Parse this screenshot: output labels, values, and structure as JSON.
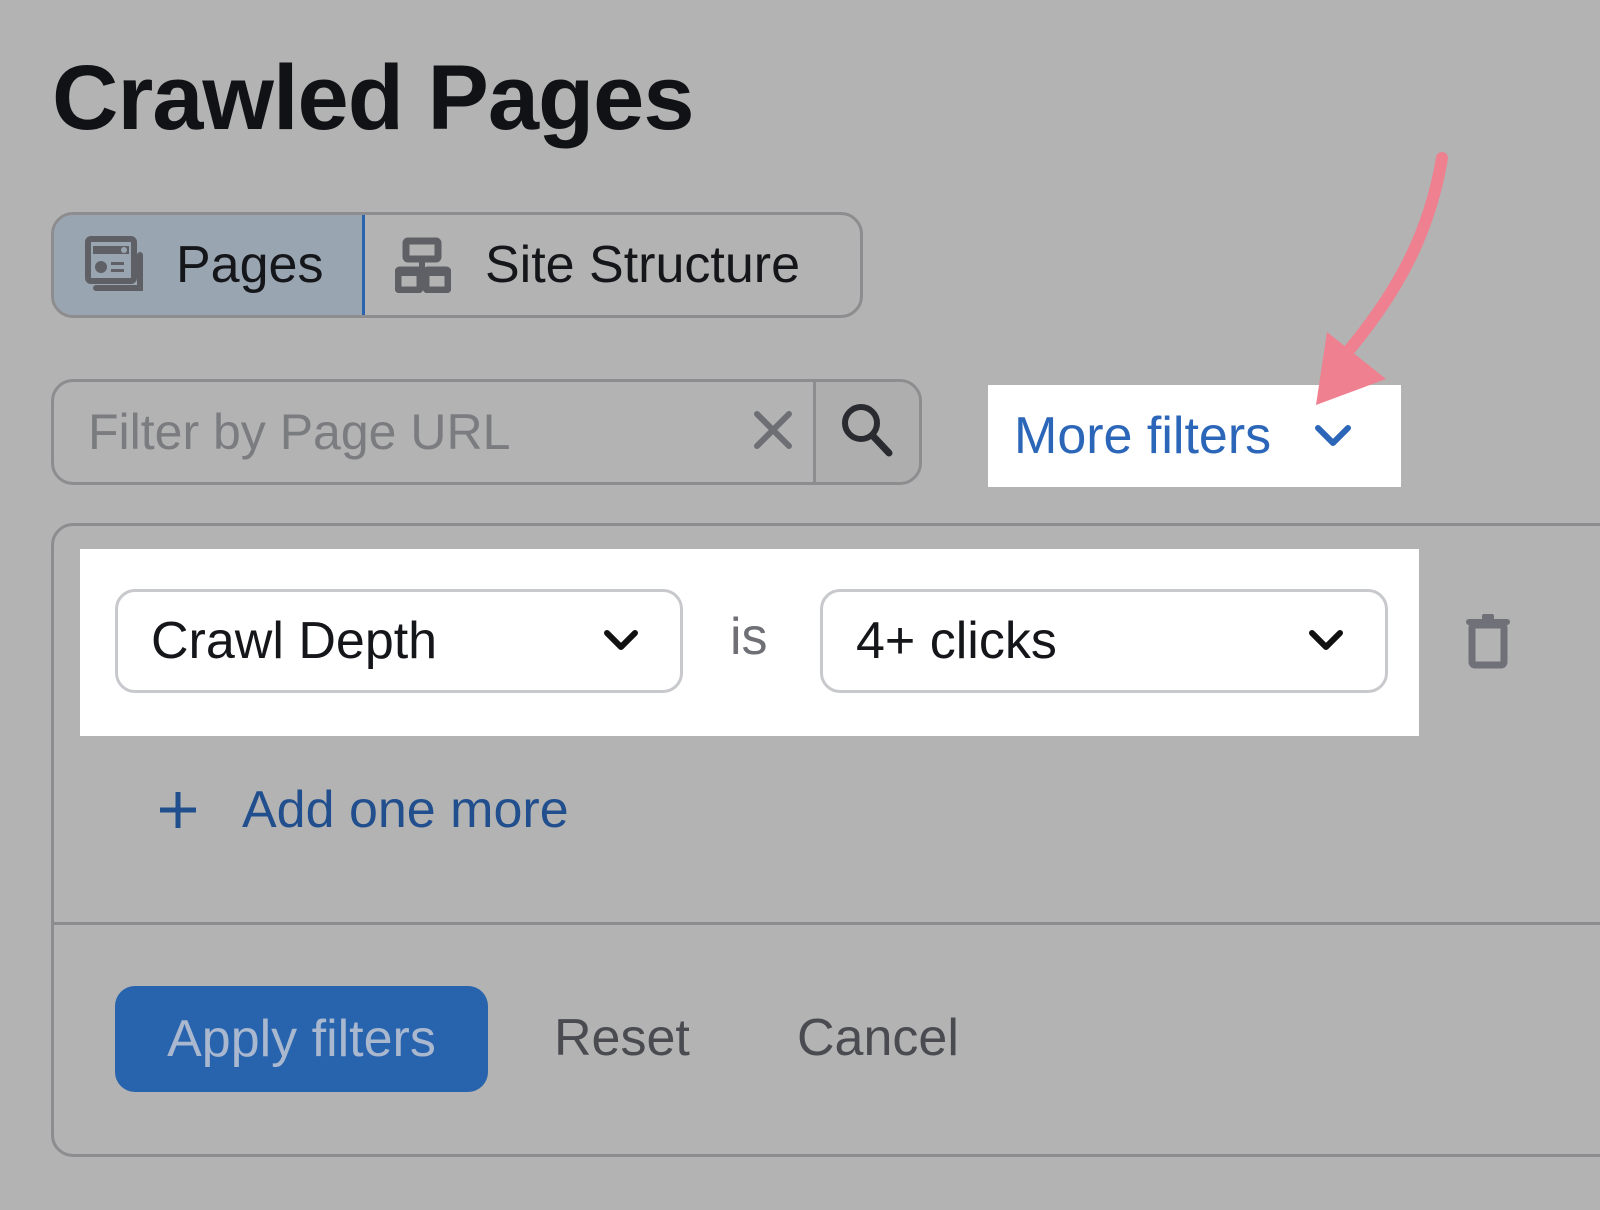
{
  "page": {
    "title": "Crawled Pages"
  },
  "view_toggle": {
    "items": [
      {
        "label": "Pages",
        "icon": "pages-icon",
        "active": true
      },
      {
        "label": "Site Structure",
        "icon": "site-structure-icon",
        "active": false
      }
    ]
  },
  "search": {
    "placeholder": "Filter by Page URL",
    "value": "",
    "clear_icon": "close-icon",
    "search_icon": "search-icon"
  },
  "more_filters": {
    "label": "More filters",
    "icon": "chevron-down-icon",
    "highlight_color": "#ffffff",
    "text_color": "#2b66b8"
  },
  "annotation": {
    "type": "arrow",
    "color": "#ee8090",
    "points_to": "more-filters-button"
  },
  "filter_panel": {
    "rows": [
      {
        "field": "Crawl Depth",
        "operator": "is",
        "value": "4+ clicks",
        "delete_icon": "trash-icon"
      }
    ],
    "add_label": "Add one more",
    "add_icon": "plus-icon",
    "actions": {
      "apply": "Apply filters",
      "reset": "Reset",
      "cancel": "Cancel"
    },
    "accent_color": "#2863ae"
  }
}
